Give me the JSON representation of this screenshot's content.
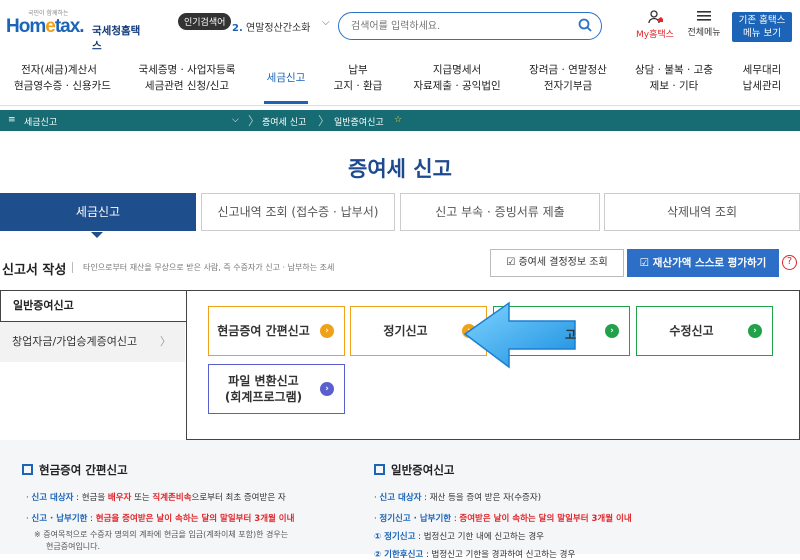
{
  "header": {
    "logo_small": "국민이 함께하는",
    "logo_brand_a": "Hom",
    "logo_brand_e": "e",
    "logo_brand_b": "tax.",
    "logo_ko": "국세청홈택스",
    "popular_badge": "인기검색어",
    "popular_rank": "2.",
    "popular_term": "연말정산간소화",
    "search_placeholder": "검색어를 입력하세요.",
    "myhome": "My홈택스",
    "allmenu": "전체메뉴",
    "old_hometax_1": "기존 홈택스",
    "old_hometax_2": "메뉴 보기"
  },
  "gnb": [
    {
      "l1": "전자(세금)계산서",
      "l2": "현금영수증 · 신용카드"
    },
    {
      "l1": "국세증명 · 사업자등록",
      "l2": "세금관련 신청/신고"
    },
    {
      "l1": "세금신고",
      "l2": ""
    },
    {
      "l1": "납부",
      "l2": "고지 · 환급"
    },
    {
      "l1": "지급명세서",
      "l2": "자료제출 · 공익법인"
    },
    {
      "l1": "장려금 · 연말정산",
      "l2": "전자기부금"
    },
    {
      "l1": "상담 · 불복 · 고충",
      "l2": "제보 · 기타"
    },
    {
      "l1": "세무대리",
      "l2": "납세관리"
    }
  ],
  "breadcrumb": {
    "menu_icon": "≡",
    "c1": "세금신고",
    "c2": "증여세 신고",
    "c3": "일반증여신고",
    "star": "☆"
  },
  "page_title": "증여세 신고",
  "tabs": [
    "세금신고",
    "신고내역 조회 (접수증 · 납부서)",
    "신고 부속 · 증빙서류 제출",
    "삭제내역 조회"
  ],
  "section": {
    "title": "신고서 작성",
    "desc": "타인으로부터 재산을 무상으로 받은 사람, 즉 수증자가 신고 · 납부하는 조세",
    "btn_decision": "증여세 결정정보 조회",
    "btn_self_eval": "재산가액 스스로 평가하기",
    "help": "?"
  },
  "left_menu": [
    "일반증여신고",
    "창업자금/가업승계증여신고"
  ],
  "cards": [
    {
      "label": "현금증여 간편신고",
      "color": "#f0a11a"
    },
    {
      "label": "정기신고",
      "color": "#f0a11a"
    },
    {
      "label": "기한후신고",
      "color": "#21a24a"
    },
    {
      "label": "수정신고",
      "color": "#21a24a"
    },
    {
      "label1": "파일 변환신고",
      "label2": "(회계프로그램)",
      "color": "#5a5fd0"
    }
  ],
  "bottom": {
    "left": {
      "title": "현금증여 간편신고",
      "line1_k": "신고 대상자",
      "line1_a": " : 현금을 ",
      "line1_r1": "배우자",
      "line1_b": " 또는 ",
      "line1_r2": "직계존비속",
      "line1_c": "으로부터 최초 증여받은 자",
      "line2_k": "신고 · 납부기한",
      "line2_a": " : ",
      "line2_r": "현금을 증여받은 날이 속하는 달의 말일부터 3개월 이내",
      "note1": "※ 증여목적으로 수증자 명의의 계좌에 현금을 입금(계좌이체 포함)한 경우는",
      "note2": "현금증여입니다."
    },
    "right": {
      "title": "일반증여신고",
      "line1_k": "신고 대상자",
      "line1_a": " : 재산 등을 증여 받은 자(수증자)",
      "line2_k": "정기신고 · 납부기한",
      "line2_a": " : ",
      "line2_r": "증여받은 날이 속하는 달의 말일부터 3개월 이내",
      "line3_k": "① 정기신고",
      "line3_a": " : 법정신고 기한 내에 신고하는 경우",
      "line4_k": "② 기한후신고",
      "line4_a": " : 법정신고 기한을 경과하여 신고하는 경우"
    }
  }
}
